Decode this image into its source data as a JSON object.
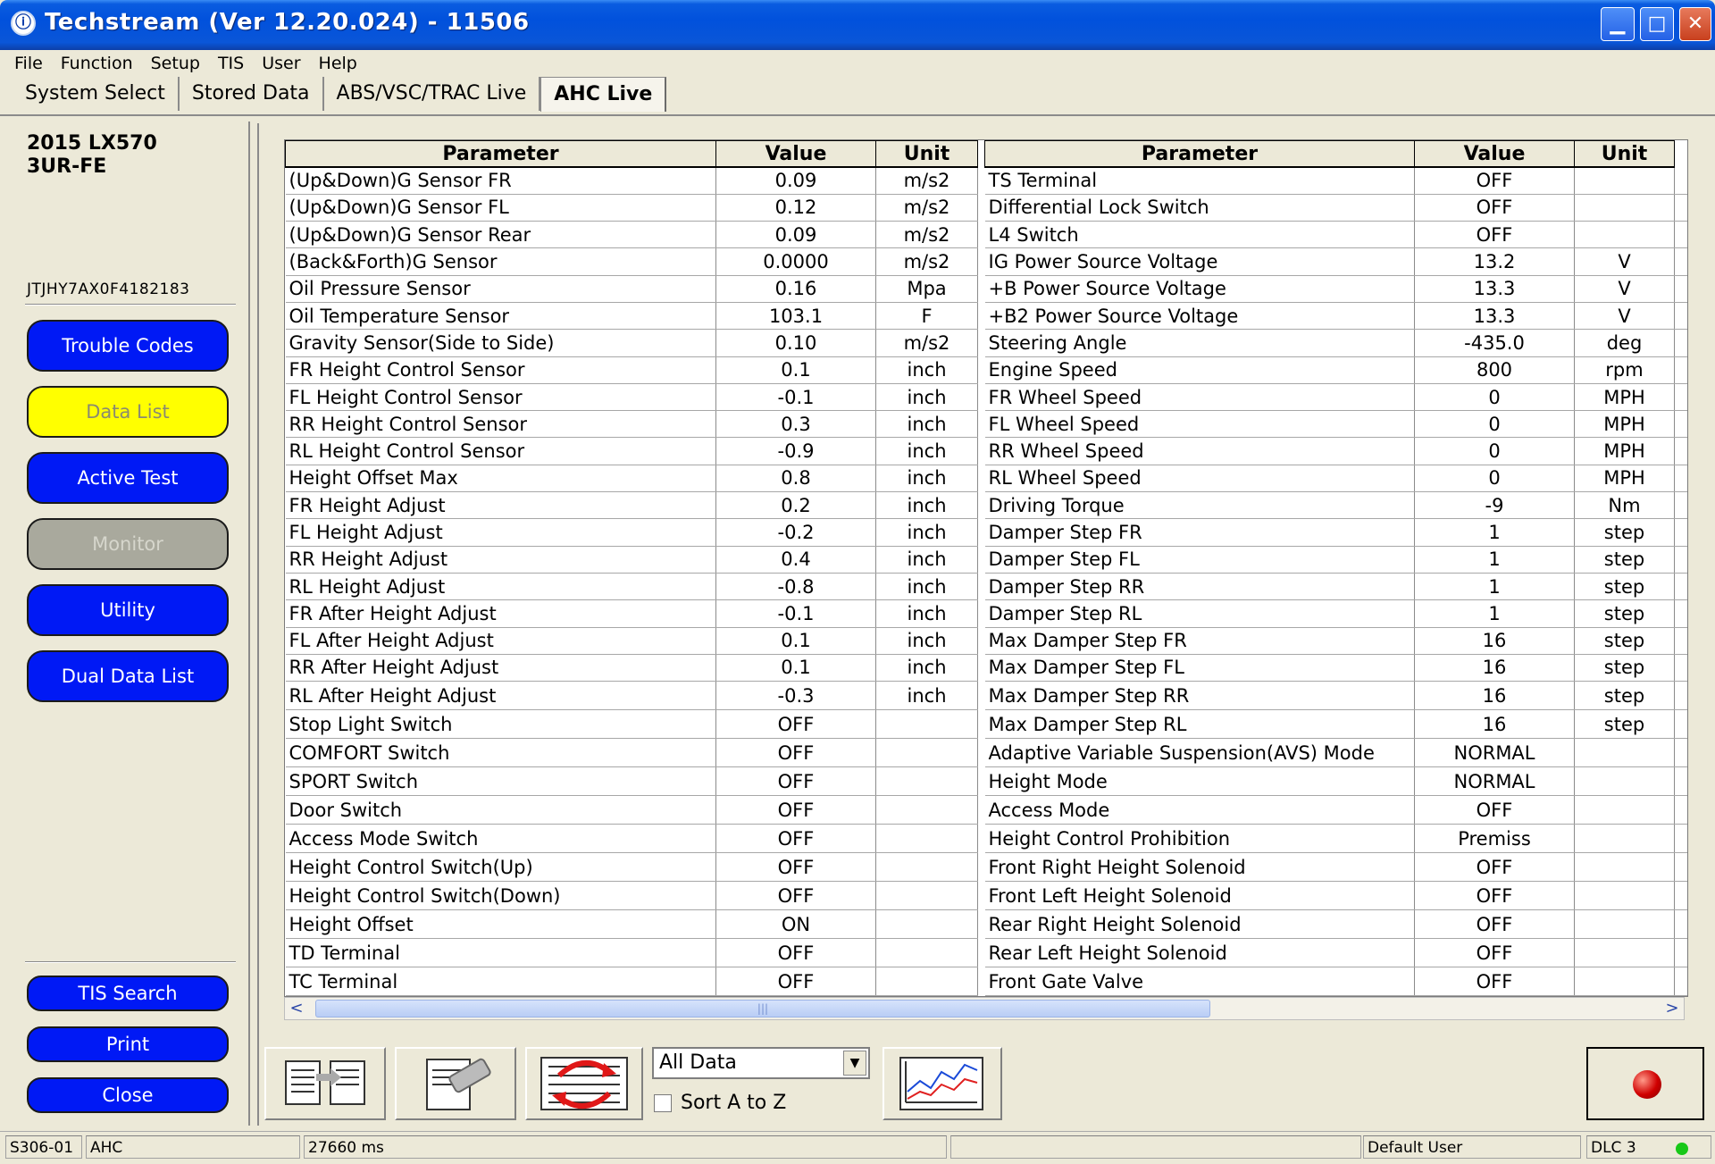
{
  "window": {
    "title": "Techstream (Ver 12.20.024) - 11506",
    "app_icon_glyph": "ⓘ"
  },
  "menu": [
    "File",
    "Function",
    "Setup",
    "TIS",
    "User",
    "Help"
  ],
  "tabs": [
    {
      "label": "System Select"
    },
    {
      "label": "Stored Data"
    },
    {
      "label": "ABS/VSC/TRAC Live"
    },
    {
      "label": "AHC Live"
    }
  ],
  "vehicle": {
    "model": "2015 LX570",
    "engine": "3UR-FE",
    "vin": "JTJHY7AX0F4182183"
  },
  "nav": {
    "trouble_codes": "Trouble Codes",
    "data_list": "Data List",
    "active_test": "Active Test",
    "monitor": "Monitor",
    "utility": "Utility",
    "dual_data_list": "Dual Data List",
    "tis_search": "TIS Search",
    "print": "Print",
    "close": "Close"
  },
  "table": {
    "headers": {
      "parameter": "Parameter",
      "value": "Value",
      "unit": "Unit"
    },
    "left_rows": [
      [
        "(Up&Down)G Sensor FR",
        "0.09",
        "m/s2"
      ],
      [
        "(Up&Down)G Sensor FL",
        "0.12",
        "m/s2"
      ],
      [
        "(Up&Down)G Sensor Rear",
        "0.09",
        "m/s2"
      ],
      [
        "(Back&Forth)G Sensor",
        "0.0000",
        "m/s2"
      ],
      [
        "Oil Pressure Sensor",
        "0.16",
        "Mpa"
      ],
      [
        "Oil Temperature Sensor",
        "103.1",
        "F"
      ],
      [
        "Gravity Sensor(Side to Side)",
        "0.10",
        "m/s2"
      ],
      [
        "FR Height Control Sensor",
        "0.1",
        "inch"
      ],
      [
        "FL Height Control Sensor",
        "-0.1",
        "inch"
      ],
      [
        "RR Height Control Sensor",
        "0.3",
        "inch"
      ],
      [
        "RL Height Control Sensor",
        "-0.9",
        "inch"
      ],
      [
        "Height Offset Max",
        "0.8",
        "inch"
      ],
      [
        "FR Height Adjust",
        "0.2",
        "inch"
      ],
      [
        "FL Height Adjust",
        "-0.2",
        "inch"
      ],
      [
        "RR Height Adjust",
        "0.4",
        "inch"
      ],
      [
        "RL Height Adjust",
        "-0.8",
        "inch"
      ],
      [
        "FR After Height Adjust",
        "-0.1",
        "inch"
      ],
      [
        "FL After Height Adjust",
        "0.1",
        "inch"
      ],
      [
        "RR After Height Adjust",
        "0.1",
        "inch"
      ],
      [
        "RL After Height Adjust",
        "-0.3",
        "inch"
      ],
      [
        "Stop Light Switch",
        "OFF",
        ""
      ],
      [
        "COMFORT Switch",
        "OFF",
        ""
      ],
      [
        "SPORT Switch",
        "OFF",
        ""
      ],
      [
        "Door Switch",
        "OFF",
        ""
      ],
      [
        "Access Mode Switch",
        "OFF",
        ""
      ],
      [
        "Height Control Switch(Up)",
        "OFF",
        ""
      ],
      [
        "Height Control Switch(Down)",
        "OFF",
        ""
      ],
      [
        "Height Offset",
        "ON",
        ""
      ],
      [
        "TD Terminal",
        "OFF",
        ""
      ],
      [
        "TC Terminal",
        "OFF",
        ""
      ]
    ],
    "right_rows": [
      [
        "TS Terminal",
        "OFF",
        ""
      ],
      [
        "Differential Lock Switch",
        "OFF",
        ""
      ],
      [
        "L4 Switch",
        "OFF",
        ""
      ],
      [
        "IG Power Source Voltage",
        "13.2",
        "V"
      ],
      [
        "+B Power Source Voltage",
        "13.3",
        "V"
      ],
      [
        "+B2 Power Source Voltage",
        "13.3",
        "V"
      ],
      [
        "Steering Angle",
        "-435.0",
        "deg"
      ],
      [
        "Engine Speed",
        "800",
        "rpm"
      ],
      [
        "FR Wheel Speed",
        "0",
        "MPH"
      ],
      [
        "FL Wheel Speed",
        "0",
        "MPH"
      ],
      [
        "RR Wheel Speed",
        "0",
        "MPH"
      ],
      [
        "RL Wheel Speed",
        "0",
        "MPH"
      ],
      [
        "Driving Torque",
        "-9",
        "Nm"
      ],
      [
        "Damper Step FR",
        "1",
        "step"
      ],
      [
        "Damper Step FL",
        "1",
        "step"
      ],
      [
        "Damper Step RR",
        "1",
        "step"
      ],
      [
        "Damper Step RL",
        "1",
        "step"
      ],
      [
        "Max Damper Step FR",
        "16",
        "step"
      ],
      [
        "Max Damper Step FL",
        "16",
        "step"
      ],
      [
        "Max Damper Step RR",
        "16",
        "step"
      ],
      [
        "Max Damper Step RL",
        "16",
        "step"
      ],
      [
        "Adaptive Variable Suspension(AVS) Mode",
        "NORMAL",
        ""
      ],
      [
        "Height Mode",
        "NORMAL",
        ""
      ],
      [
        "Access Mode",
        "OFF",
        ""
      ],
      [
        "Height Control Prohibition",
        "Premiss",
        ""
      ],
      [
        "Front Right Height Solenoid",
        "OFF",
        ""
      ],
      [
        "Front Left Height Solenoid",
        "OFF",
        ""
      ],
      [
        "Rear Right Height Solenoid",
        "OFF",
        ""
      ],
      [
        "Rear Left Height Solenoid",
        "OFF",
        ""
      ],
      [
        "Front Gate Valve",
        "OFF",
        ""
      ]
    ]
  },
  "scrollbar": {
    "left_arrow": "<",
    "right_arrow": ">",
    "grip": "|||"
  },
  "toolbar": {
    "filter_selected": "All Data",
    "sort_label": "Sort A to Z",
    "dropdown_arrow": "▼",
    "icons": [
      "list-transfer-icon",
      "clipboard-tool-icon",
      "refresh-list-icon",
      "line-graph-icon",
      "record-icon"
    ]
  },
  "status": {
    "code": "S306-01",
    "system": "AHC",
    "time": "27660 ms",
    "user": "Default User",
    "connection": "DLC 3"
  },
  "colors": {
    "nav_blue": "#0019f5",
    "nav_yellow": "#ffff00",
    "nav_gray": "#a9a99d",
    "titlebar": "#0151dc",
    "status_ok": "#18c818"
  }
}
